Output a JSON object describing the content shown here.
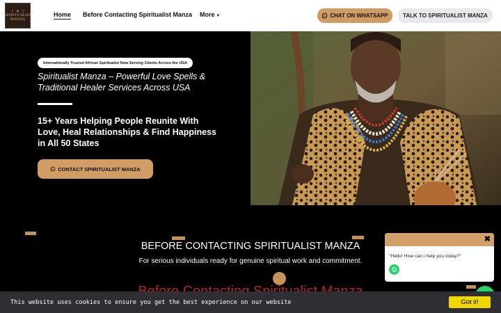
{
  "logo": {
    "line1": "SPIRITUALIST",
    "line2": "MANZA"
  },
  "nav": {
    "home": "Home",
    "before": "Before Contacting Spiritualist Manza",
    "more": "More"
  },
  "header_buttons": {
    "whatsapp": "CHAT ON WHATSAPP",
    "talk": "TALK TO SPIRITUALIST MANZA"
  },
  "hero": {
    "badge": "Internationally Trusted African Spiritualist Now Serving Clients Across the USA",
    "subtitle": "Spiritualist Manza – Powerful Love Spells & Traditional Healer Services Across USA",
    "heading": "15+ Years Helping People Reunite With Love, Heal Relationships & Find Happiness in All 50 States",
    "cta": "CONTACT SPIRITUALIST MANZA"
  },
  "section": {
    "title": "BEFORE CONTACTING SPIRITUALIST MANZA",
    "subtitle": "For serious individuals ready for genuine spiritual work and commitment.",
    "red_heading": "Before Contacting Spiritualist Manza"
  },
  "chat": {
    "message": "\"Hello! How can i help you today?\"",
    "close_icon": "close-icon"
  },
  "cookie": {
    "text": "This website uses cookies to ensure you get the best experience on our website",
    "button": "Got it!"
  },
  "colors": {
    "accent": "#d09d64",
    "whatsapp": "#25d366",
    "cookie_button": "#f1d600",
    "red_heading": "#b3281f"
  }
}
